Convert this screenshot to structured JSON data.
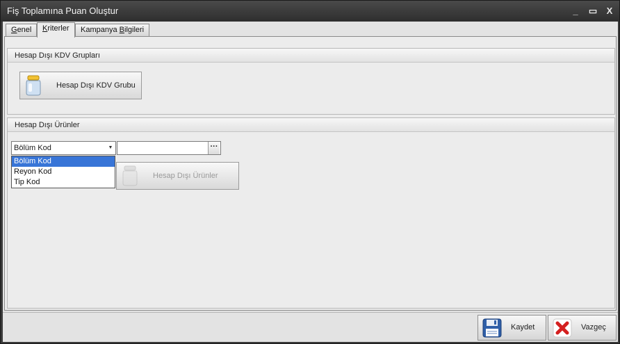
{
  "window": {
    "title": "Fiş Toplamına Puan Oluştur",
    "controls": {
      "minimize": "_",
      "maximize": "▭",
      "close": "X"
    }
  },
  "tabs": [
    {
      "label_pre": "",
      "label_ul": "G",
      "label_post": "enel"
    },
    {
      "label_pre": "",
      "label_ul": "K",
      "label_post": "riterler"
    },
    {
      "label_pre": "Kampanya ",
      "label_ul": "B",
      "label_post": "ilgileri"
    }
  ],
  "active_tab": 1,
  "groups": {
    "kdv": {
      "header": "Hesap Dışı KDV Grupları",
      "button_label": "Hesap Dışı KDV Grubu"
    },
    "products": {
      "header": "Hesap Dışı Ürünler",
      "combo_value": "Bölüm Kod",
      "lookup_value": "",
      "lookup_button": "···",
      "button_label": "Hesap Dışı Ürünler",
      "dropdown_options": [
        "Bölüm Kod",
        "Reyon Kod",
        "Tip Kod"
      ],
      "dropdown_selected": 0
    }
  },
  "footer": {
    "save_label": "Kaydet",
    "cancel_label": "Vazgeç"
  },
  "colors": {
    "titlebar": "#3a3a3a",
    "selection": "#3875d7",
    "cancel_icon": "#d42020"
  }
}
